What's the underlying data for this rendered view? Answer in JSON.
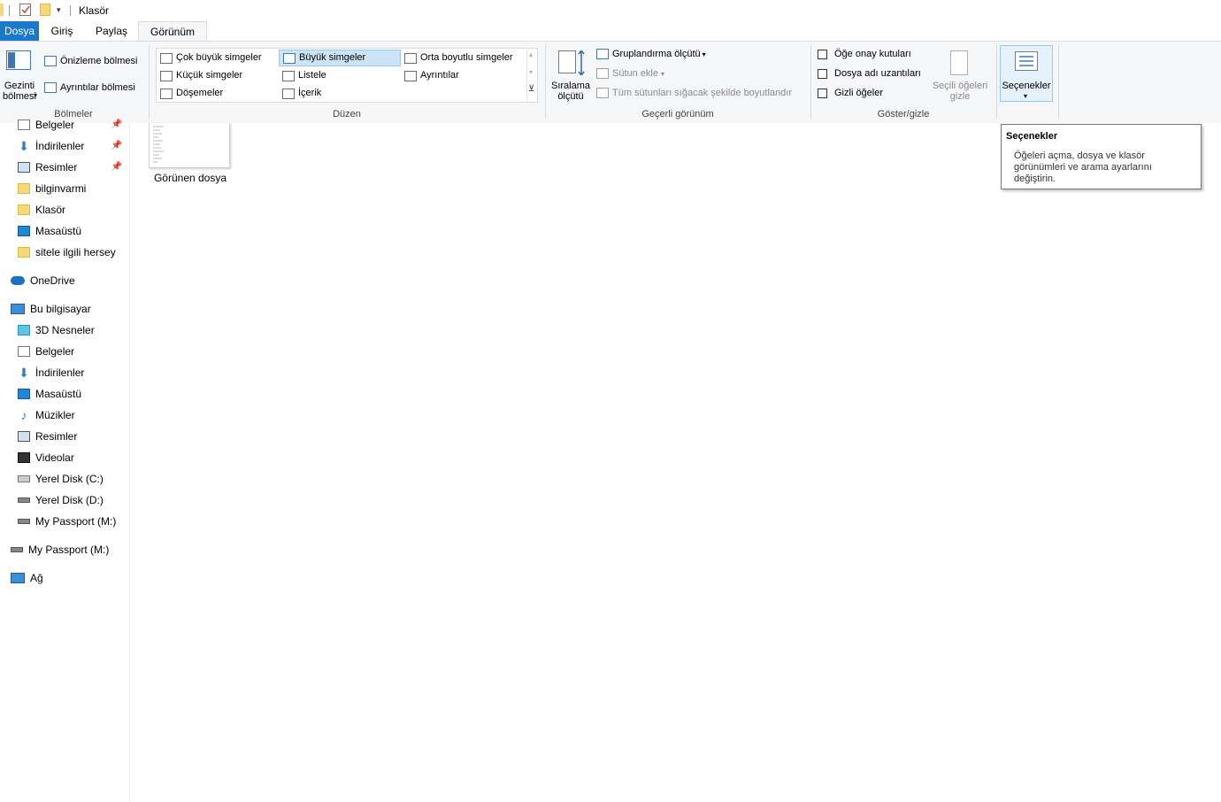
{
  "window": {
    "title": "Klasör"
  },
  "tabs": {
    "file": "Dosya",
    "home": "Giriş",
    "share": "Paylaş",
    "view": "Görünüm"
  },
  "ribbon": {
    "panes": {
      "nav_pane": "Gezinti bölmesi",
      "preview_pane": "Önizleme bölmesi",
      "details_pane": "Ayrıntılar bölmesi",
      "label": "Bölmeler"
    },
    "layout": {
      "label": "Düzen",
      "items": [
        "Çok büyük simgeler",
        "Büyük simgeler",
        "Orta boyutlu simgeler",
        "Küçük simgeler",
        "Listele",
        "Ayrıntılar",
        "Döşemeler",
        "İçerik"
      ],
      "selected": "Büyük simgeler"
    },
    "current_view": {
      "label": "Geçerli görünüm",
      "sort_by": "Sıralama ölçütü",
      "group_by": "Gruplandırma ölçütü",
      "add_columns": "Sütun ekle",
      "size_columns": "Tüm sütunları sığacak şekilde boyutlandır"
    },
    "show_hide": {
      "label": "Göster/gizle",
      "item_checkboxes": "Öğe onay kutuları",
      "file_extensions": "Dosya adı uzantıları",
      "hidden_items": "Gizli öğeler",
      "hide_selected": "Seçili öğeleri gizle"
    },
    "options": {
      "label": "Seçenekler"
    }
  },
  "nav": {
    "quick": [
      {
        "label": "Belgeler",
        "pinned": true
      },
      {
        "label": "İndirilenler",
        "pinned": true
      },
      {
        "label": "Resimler",
        "pinned": true
      },
      {
        "label": "bilginvarmi"
      },
      {
        "label": "Klasör"
      },
      {
        "label": "Masaüstü"
      },
      {
        "label": "sitele ilgili hersey"
      }
    ],
    "onedrive": "OneDrive",
    "this_pc": "Bu bilgisayar",
    "pc_items": [
      "3D Nesneler",
      "Belgeler",
      "İndirilenler",
      "Masaüstü",
      "Müzikler",
      "Resimler",
      "Videolar",
      "Yerel Disk (C:)",
      "Yerel Disk (D:)",
      "My Passport (M:)"
    ],
    "passport": "My Passport (M:)",
    "network": "Ağ"
  },
  "content": {
    "file_label": "Görünen dosya"
  },
  "tooltip": {
    "title": "Seçenekler",
    "body": "Öğeleri açma, dosya ve klasör görünümleri ve arama ayarlarını değiştirin."
  },
  "colors": {
    "accent": "#1979ca",
    "ribbon_bg": "#f5f6f7",
    "selected_bg": "#cce4f7"
  }
}
